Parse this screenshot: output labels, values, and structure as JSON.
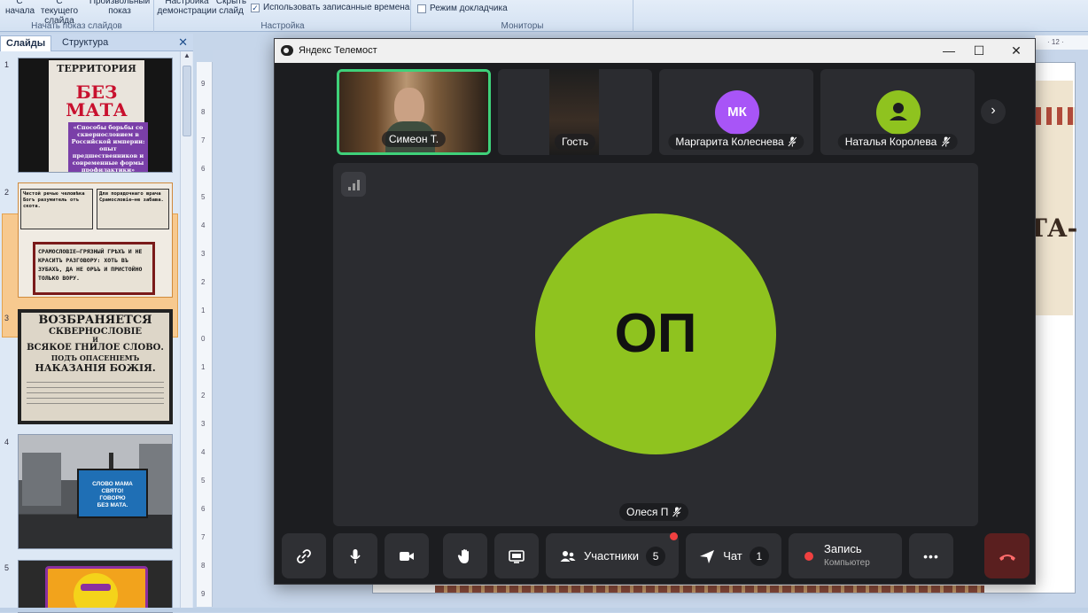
{
  "ribbon": {
    "start_group": {
      "from_start": "С начала",
      "from_current": "С текущего слайда",
      "custom": "Произвольный показ",
      "label": "Начать показ слайдов"
    },
    "setup_group": {
      "setup": "Настройка демонстрации",
      "hide": "Скрыть слайд",
      "use_timings": "Использовать записанные времена",
      "label": "Настройка"
    },
    "monitors_group": {
      "presenter_mode": "Режим докладчика",
      "label": "Мониторы"
    }
  },
  "slides_panel": {
    "tab_slides": "Слайды",
    "tab_outline": "Структура",
    "close": "✕",
    "thumbs": [
      {
        "num": "1",
        "title": "ТЕРРИТОРИЯ",
        "big": "БЕЗ МАТА",
        "caption": "«Способы борьбы со сквернословием в Российской империи: опыт предшественников и современные формы профилактики»"
      },
      {
        "num": "2",
        "text_a": "Чистой речью человѣка Богъ разумитель отъ скота.",
        "text_b": "Для порядочнаго врача Срамословіе—не забава.",
        "text_c": "СРАМОСЛОВІЕ—ГРЯЗНЫЙ ГРѢХЪ И НЕ КРАСИТЪ РАЗГОВОРУ: ХОТЬ ВЪ ЗУБАХЪ, ДА НЕ ОРЪЪ И ПРИСТОЙНО ТОЛЬКО ВОРУ."
      },
      {
        "num": "3",
        "l1": "ВОЗБРАНЯЕТСЯ",
        "l2": "СКВЕРНОСЛОВІЕ",
        "l3": "И",
        "l4": "ВСЯКОЕ ГНИЛОЕ СЛОВО.",
        "l5": "ПОДЪ ОПАСЕНІЕМЪ",
        "l6": "НАКАЗАНІЯ БОЖІЯ."
      },
      {
        "num": "4",
        "ad1": "СЛОВО МАМА",
        "ad2": "СВЯТО!",
        "ad3": "ГОВОРЮ",
        "ad4": "БЕЗ МАТА."
      },
      {
        "num": "5"
      }
    ]
  },
  "ruler": {
    "marks": [
      "9",
      "8",
      "7",
      "6",
      "5",
      "4",
      "3",
      "2",
      "1",
      "0",
      "1",
      "2",
      "3",
      "4",
      "5",
      "6",
      "7",
      "8",
      "9"
    ],
    "top": "· 12 ·"
  },
  "slide": {
    "text": "ТА-"
  },
  "telemost": {
    "title": "Яндекс Телемост",
    "participants": [
      {
        "name": "Симеон Т.",
        "type": "video",
        "active": true,
        "muted": false
      },
      {
        "name": "Гость",
        "type": "video",
        "active": false,
        "muted": false
      },
      {
        "name": "Маргарита Колеснева",
        "initials": "МК",
        "type": "avatar",
        "muted": true,
        "color": "#a855f7"
      },
      {
        "name": "Наталья Королева",
        "type": "avatar-icon",
        "muted": true,
        "color": "#8fc31f"
      }
    ],
    "speaker": {
      "initials": "ОП",
      "name": "Олеся П",
      "muted": true,
      "color": "#8fc31f"
    },
    "controls": {
      "participants_label": "Участники",
      "participants_count": "5",
      "chat_label": "Чат",
      "chat_count": "1",
      "record_label": "Запись",
      "record_sub": "Компьютер",
      "more": "•••"
    },
    "colors": {
      "accent_active": "#3fd17a",
      "hangup": "#5a1f1f",
      "bg": "#1c1d20"
    }
  }
}
